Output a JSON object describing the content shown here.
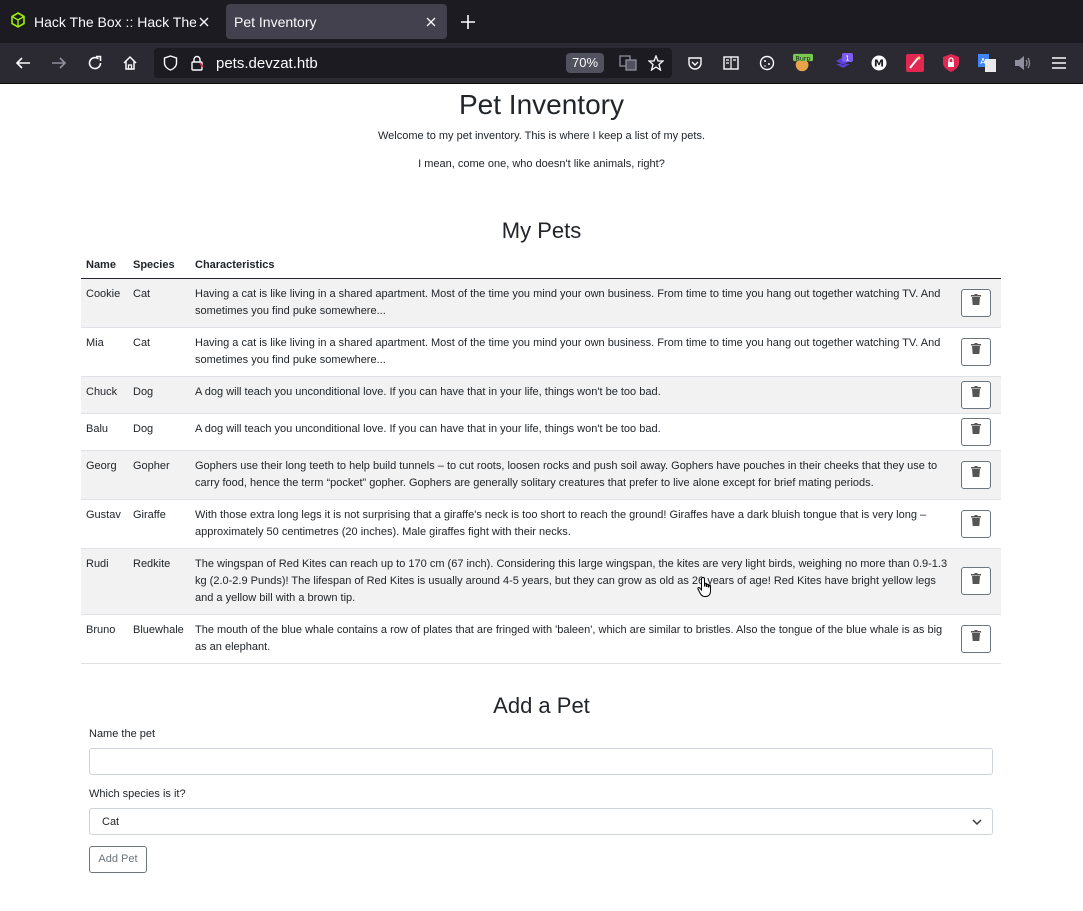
{
  "browser": {
    "tabs": [
      {
        "title": "Hack The Box :: Hack The",
        "active": false,
        "icon": "htb-cube-icon"
      },
      {
        "title": "Pet Inventory",
        "active": true
      }
    ],
    "url": "pets.devzat.htb",
    "zoom": "70%",
    "extensions": [
      "pocket-icon",
      "reader-icon",
      "cookie-icon",
      "burp-icon",
      "extension-1-icon",
      "m-icon",
      "wappalyzer-icon",
      "ublock-icon",
      "translate-icon",
      "speaker-icon"
    ],
    "extension_badges": {
      "burp": "Burp",
      "ext1": "1"
    }
  },
  "page": {
    "title": "Pet Inventory",
    "intro1": "Welcome to my pet inventory. This is where I keep a list of my pets.",
    "intro2": "I mean, come one, who doesn't like animals, right?",
    "pets_heading": "My Pets",
    "columns": {
      "name": "Name",
      "species": "Species",
      "characteristics": "Characteristics"
    },
    "pets": [
      {
        "name": "Cookie",
        "species": "Cat",
        "characteristics": "Having a cat is like living in a shared apartment. Most of the time you mind your own business. From time to time you hang out together watching TV. And sometimes you find puke somewhere..."
      },
      {
        "name": "Mia",
        "species": "Cat",
        "characteristics": "Having a cat is like living in a shared apartment. Most of the time you mind your own business. From time to time you hang out together watching TV. And sometimes you find puke somewhere..."
      },
      {
        "name": "Chuck",
        "species": "Dog",
        "characteristics": "A dog will teach you unconditional love. If you can have that in your life, things won't be too bad."
      },
      {
        "name": "Balu",
        "species": "Dog",
        "characteristics": "A dog will teach you unconditional love. If you can have that in your life, things won't be too bad."
      },
      {
        "name": "Georg",
        "species": "Gopher",
        "characteristics": "Gophers use their long teeth to help build tunnels – to cut roots, loosen rocks and push soil away. Gophers have pouches in their cheeks that they use to carry food, hence the term “pocket” gopher. Gophers are generally solitary creatures that prefer to live alone except for brief mating periods."
      },
      {
        "name": "Gustav",
        "species": "Giraffe",
        "characteristics": "With those extra long legs it is not surprising that a giraffe's neck is too short to reach the ground! Giraffes have a dark bluish tongue that is very long – approximately 50 centimetres (20 inches). Male giraffes fight with their necks."
      },
      {
        "name": "Rudi",
        "species": "Redkite",
        "characteristics": "The wingspan of Red Kites can reach up to 170 cm (67 inch). Considering this large wingspan, the kites are very light birds, weighing no more than 0.9-1.3 kg (2.0-2.9 Punds)! The lifespan of Red Kites is usually around 4-5 years, but they can grow as old as 26 years of age! Red Kites have bright yellow legs and a yellow bill with a brown tip."
      },
      {
        "name": "Bruno",
        "species": "Bluewhale",
        "characteristics": "The mouth of the blue whale contains a row of plates that are fringed with 'baleen', which are similar to bristles. Also the tongue of the blue whale is as big as an elephant."
      }
    ],
    "add_heading": "Add a Pet",
    "form": {
      "name_label": "Name the pet",
      "name_value": "",
      "species_label": "Which species is it?",
      "species_selected": "Cat",
      "submit_label": "Add Pet"
    }
  }
}
